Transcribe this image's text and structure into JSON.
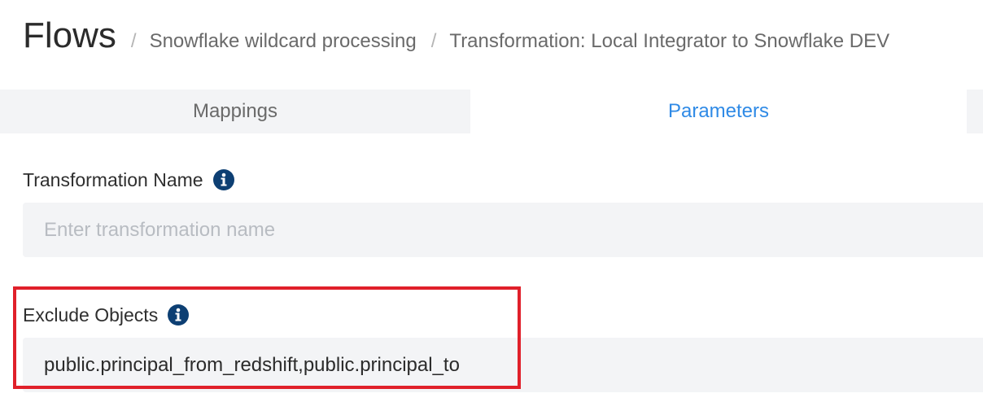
{
  "breadcrumb": {
    "root": "Flows",
    "separator": "/",
    "items": [
      "Snowflake wildcard processing",
      "Transformation: Local Integrator to Snowflake DEV"
    ]
  },
  "tabs": [
    {
      "label": "Mappings",
      "active": false
    },
    {
      "label": "Parameters",
      "active": true
    }
  ],
  "form": {
    "transformation_name": {
      "label": "Transformation Name",
      "value": "",
      "placeholder": "Enter transformation name",
      "icon": "info-icon"
    },
    "exclude_objects": {
      "label": "Exclude Objects",
      "value": "public.principal_from_redshift,public.principal_to",
      "placeholder": "",
      "icon": "info-icon"
    }
  },
  "colors": {
    "accent": "#2f8ae6",
    "info_icon": "#0d3f73",
    "highlight": "#e0202a",
    "tab_bg": "#f3f4f6"
  }
}
